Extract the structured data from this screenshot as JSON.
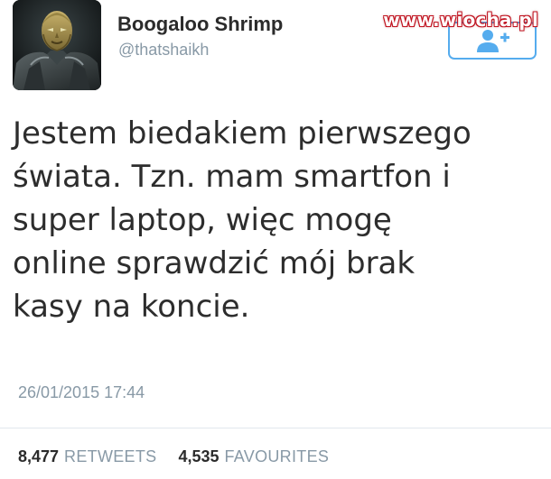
{
  "watermark": "www.wiocha.pl",
  "tweet": {
    "display_name": "Boogaloo Shrimp",
    "handle": "@thatshaikh",
    "text": "Jestem biedakiem pierwszego\nświata. Tzn. mam smartfon i\nsuper laptop, więc mogę\nonline sprawdzić mój brak\nkasy na koncie.",
    "timestamp": "26/01/2015 17:44",
    "retweets": {
      "count": "8,477",
      "label": "RETWEETS"
    },
    "favourites": {
      "count": "4,535",
      "label": "FAVOURITES"
    }
  },
  "icons": {
    "avatar": "avatar-image",
    "follow": "follow-user-icon"
  },
  "colors": {
    "accent": "#55acee",
    "text": "#2d2d2d",
    "muted": "#8899a6",
    "divider": "#e1e8ed"
  }
}
